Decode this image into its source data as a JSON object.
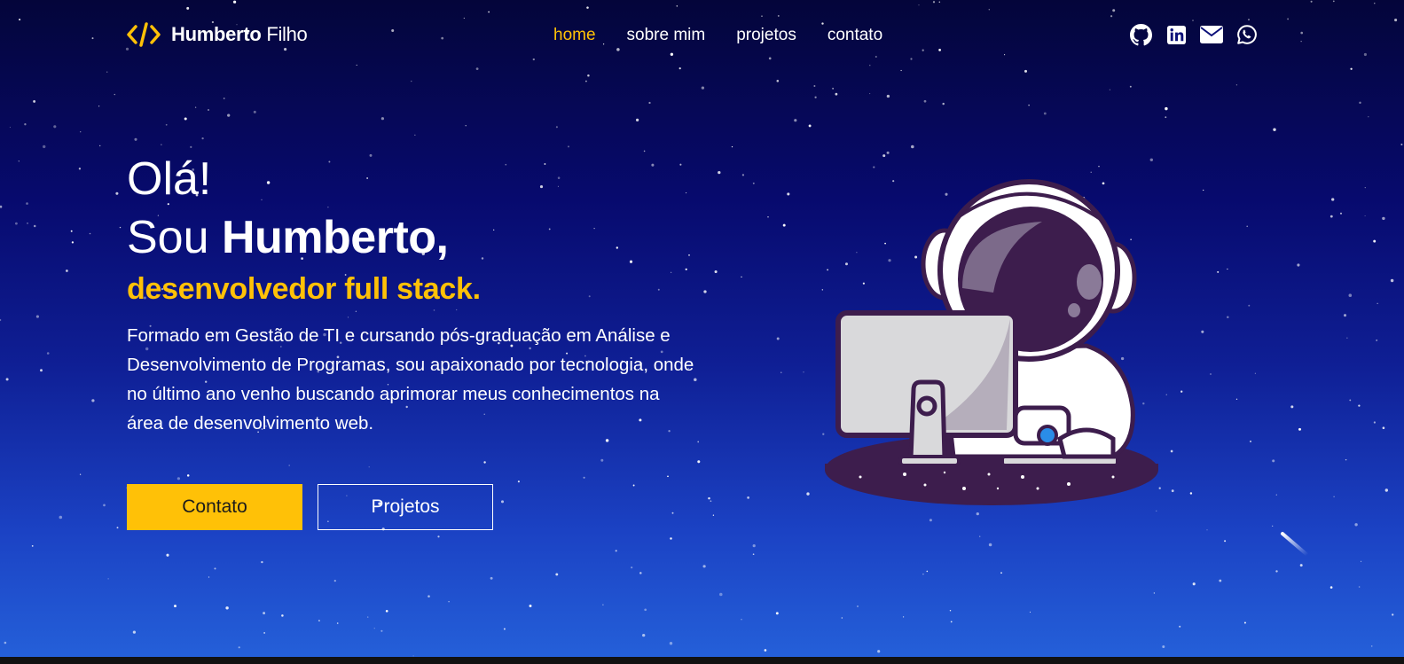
{
  "header": {
    "logo_icon": "code-brackets-icon",
    "logo_first": "Humberto",
    "logo_last": "Filho",
    "nav": [
      {
        "label": "home",
        "active": true
      },
      {
        "label": "sobre mim",
        "active": false
      },
      {
        "label": "projetos",
        "active": false
      },
      {
        "label": "contato",
        "active": false
      }
    ],
    "social_icons": [
      "github-icon",
      "linkedin-icon",
      "envelope-icon",
      "whatsapp-icon"
    ]
  },
  "hero": {
    "greeting": "Olá!",
    "intro_prefix": "Sou",
    "name": "Humberto,",
    "role": "desenvolvedor full stack.",
    "description": "Formado em Gestão de TI e cursando pós-graduação em Análise e Desenvolvimento de Programas, sou apaixonado por tecnologia, onde no último ano venho buscando aprimorar meus conhecimentos na área de desenvolvimento web.",
    "buttons": {
      "primary": "Contato",
      "secondary": "Projetos"
    },
    "illustration": "astronaut-computer-illustration"
  },
  "colors": {
    "accent": "#ffc107",
    "bg_top": "#04053a",
    "bg_bottom": "#2561da",
    "text": "#ffffff"
  }
}
